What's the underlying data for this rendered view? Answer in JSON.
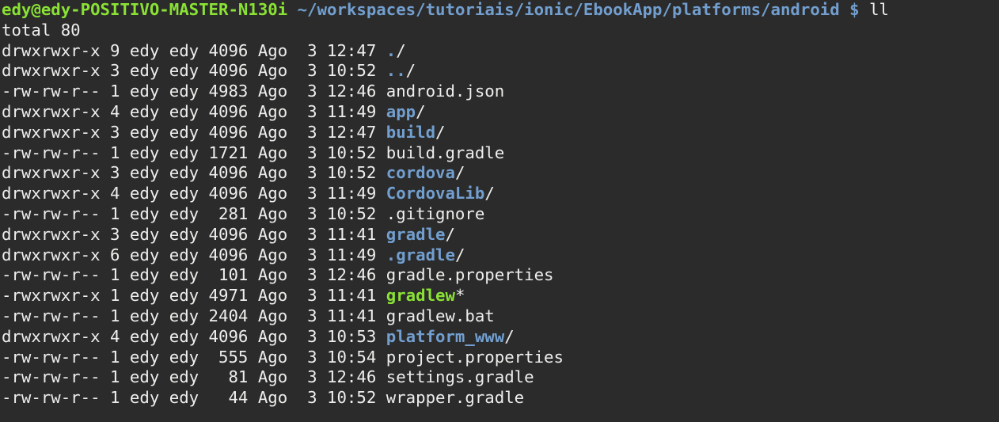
{
  "colors": {
    "background": "#2b2b2b",
    "text": "#eeeeec",
    "prompt_user": "#8ae234",
    "directory": "#729fcf",
    "executable": "#8ae234"
  },
  "prompt": {
    "user_host": "edy@edy-POSITIVO-MASTER-N130i",
    "path_and_symbol": "~/workspaces/tutoriais/ionic/EbookApp/platforms/android $",
    "command": "ll"
  },
  "total_line": "total 80",
  "entries": [
    {
      "meta": "drwxrwxr-x 9 edy edy 4096 Ago  3 12:47 ",
      "name": ".",
      "suffix": "/",
      "type": "dir"
    },
    {
      "meta": "drwxrwxr-x 3 edy edy 4096 Ago  3 10:52 ",
      "name": "..",
      "suffix": "/",
      "type": "dir"
    },
    {
      "meta": "-rw-rw-r-- 1 edy edy 4983 Ago  3 12:46 ",
      "name": "android.json",
      "suffix": "",
      "type": "file"
    },
    {
      "meta": "drwxrwxr-x 4 edy edy 4096 Ago  3 11:49 ",
      "name": "app",
      "suffix": "/",
      "type": "dir"
    },
    {
      "meta": "drwxrwxr-x 3 edy edy 4096 Ago  3 12:47 ",
      "name": "build",
      "suffix": "/",
      "type": "dir"
    },
    {
      "meta": "-rw-rw-r-- 1 edy edy 1721 Ago  3 10:52 ",
      "name": "build.gradle",
      "suffix": "",
      "type": "file"
    },
    {
      "meta": "drwxrwxr-x 3 edy edy 4096 Ago  3 10:52 ",
      "name": "cordova",
      "suffix": "/",
      "type": "dir"
    },
    {
      "meta": "drwxrwxr-x 4 edy edy 4096 Ago  3 11:49 ",
      "name": "CordovaLib",
      "suffix": "/",
      "type": "dir"
    },
    {
      "meta": "-rw-rw-r-- 1 edy edy  281 Ago  3 10:52 ",
      "name": ".gitignore",
      "suffix": "",
      "type": "file"
    },
    {
      "meta": "drwxrwxr-x 3 edy edy 4096 Ago  3 11:41 ",
      "name": "gradle",
      "suffix": "/",
      "type": "dir"
    },
    {
      "meta": "drwxrwxr-x 6 edy edy 4096 Ago  3 11:49 ",
      "name": ".gradle",
      "suffix": "/",
      "type": "dir"
    },
    {
      "meta": "-rw-rw-r-- 1 edy edy  101 Ago  3 12:46 ",
      "name": "gradle.properties",
      "suffix": "",
      "type": "file"
    },
    {
      "meta": "-rwxrwxr-x 1 edy edy 4971 Ago  3 11:41 ",
      "name": "gradlew",
      "suffix": "*",
      "type": "exe"
    },
    {
      "meta": "-rw-rw-r-- 1 edy edy 2404 Ago  3 11:41 ",
      "name": "gradlew.bat",
      "suffix": "",
      "type": "file"
    },
    {
      "meta": "drwxrwxr-x 4 edy edy 4096 Ago  3 10:53 ",
      "name": "platform_www",
      "suffix": "/",
      "type": "dir"
    },
    {
      "meta": "-rw-rw-r-- 1 edy edy  555 Ago  3 10:54 ",
      "name": "project.properties",
      "suffix": "",
      "type": "file"
    },
    {
      "meta": "-rw-rw-r-- 1 edy edy   81 Ago  3 12:46 ",
      "name": "settings.gradle",
      "suffix": "",
      "type": "file"
    },
    {
      "meta": "-rw-rw-r-- 1 edy edy   44 Ago  3 10:52 ",
      "name": "wrapper.gradle",
      "suffix": "",
      "type": "file"
    }
  ]
}
